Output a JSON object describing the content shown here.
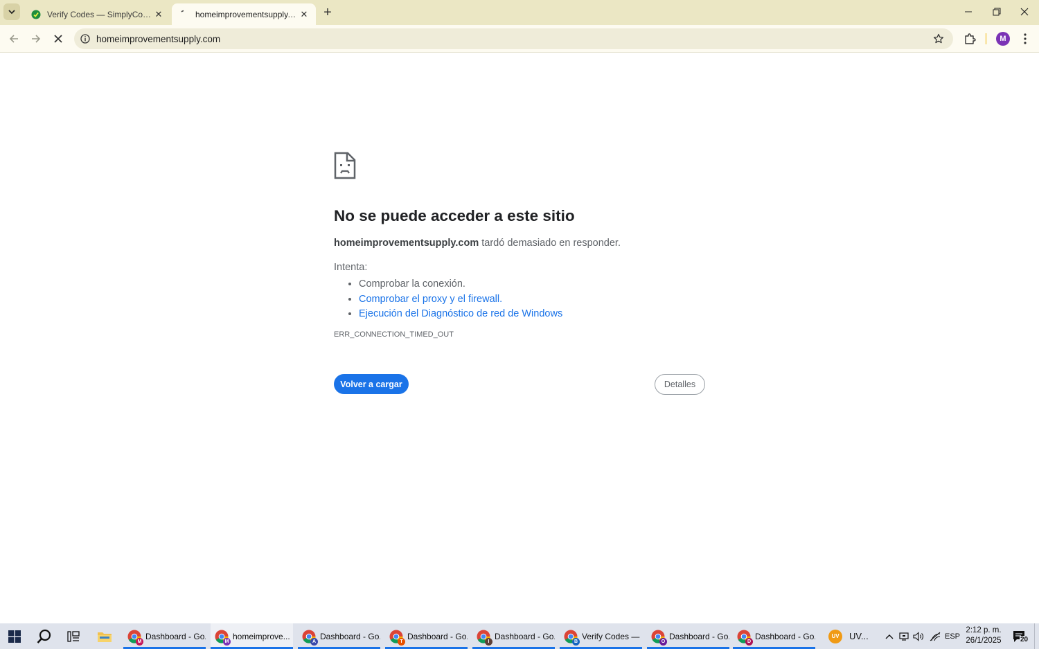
{
  "browser": {
    "tabs": [
      {
        "title": "Verify Codes — SimplyCodes",
        "active": false,
        "favicon": "simplycodes-logo-icon"
      },
      {
        "title": "homeimprovementsupply.com",
        "active": true,
        "favicon": "loading-spinner-icon"
      }
    ],
    "address_bar": {
      "url": "homeimprovementsupply.com"
    },
    "profile_initial": "M"
  },
  "error_page": {
    "heading": "No se puede acceder a este sitio",
    "host": "homeimprovementsupply.com",
    "message": " tardó demasiado en responder.",
    "try_label": "Intenta:",
    "suggestions": [
      {
        "text": "Comprobar la conexión.",
        "link": false
      },
      {
        "text": "Comprobar el proxy y el firewall.",
        "link": true
      },
      {
        "text": "Ejecución del Diagnóstico de red de Windows",
        "link": true
      }
    ],
    "error_code": "ERR_CONNECTION_TIMED_OUT",
    "reload_label": "Volver a cargar",
    "details_label": "Detalles"
  },
  "taskbar": {
    "apps": [
      {
        "label": "Dashboard - Go...",
        "badge": "M",
        "badge_color": "#c2185b",
        "active": false
      },
      {
        "label": "homeimprove...",
        "badge": "M",
        "badge_color": "#7b33b5",
        "active": true
      },
      {
        "label": "Dashboard - Go...",
        "badge": "A",
        "badge_color": "#3949ab",
        "active": false
      },
      {
        "label": "Dashboard - Go...",
        "badge": "T",
        "badge_color": "#e65100",
        "active": false
      },
      {
        "label": "Dashboard - Go...",
        "badge": "I",
        "badge_color": "#5d4037",
        "active": false
      },
      {
        "label": "Verify Codes — ...",
        "badge": "B",
        "badge_color": "#1565c0",
        "active": false
      },
      {
        "label": "Dashboard - Go...",
        "badge": "O",
        "badge_color": "#6a1b9a",
        "active": false
      },
      {
        "label": "Dashboard - Go...",
        "badge": "D",
        "badge_color": "#ad1457",
        "active": false
      }
    ],
    "tray_app_label": "UV...",
    "tray_app_icon": "UV",
    "language": "ESP",
    "time": "2:12 p. m.",
    "date": "26/1/2025",
    "notification_count": "20"
  },
  "colors": {
    "tabstrip": "#ebe7c4",
    "toolbar": "#fdfbf1",
    "link": "#1a73e8",
    "primary_button": "#1a73e8",
    "taskbar": "#dfe3ec"
  }
}
